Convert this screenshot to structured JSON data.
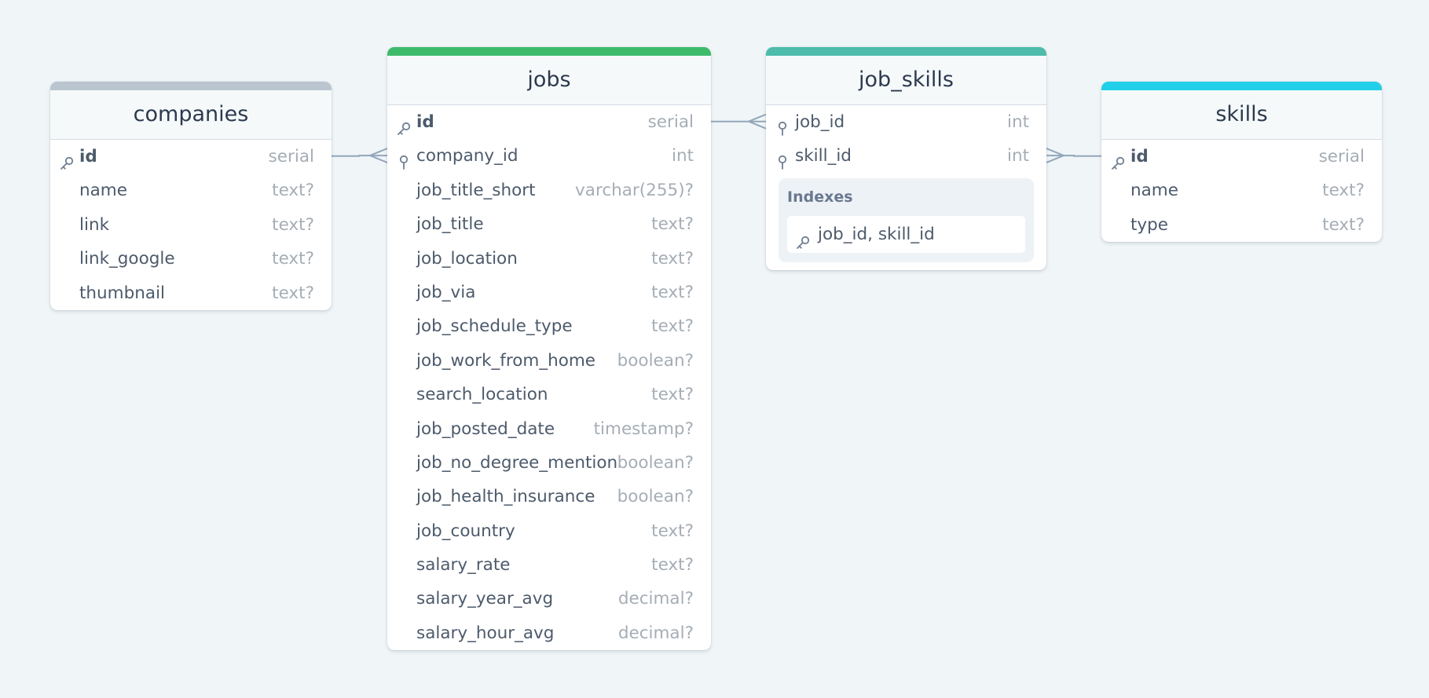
{
  "tables": [
    {
      "name": "companies",
      "accent_color": "#bac5d0",
      "columns": [
        {
          "name": "id",
          "type": "serial",
          "key": "pk"
        },
        {
          "name": "name",
          "type": "text?",
          "key": ""
        },
        {
          "name": "link",
          "type": "text?",
          "key": ""
        },
        {
          "name": "link_google",
          "type": "text?",
          "key": ""
        },
        {
          "name": "thumbnail",
          "type": "text?",
          "key": ""
        }
      ]
    },
    {
      "name": "jobs",
      "accent_color": "#3dbb6b",
      "columns": [
        {
          "name": "id",
          "type": "serial",
          "key": "pk"
        },
        {
          "name": "company_id",
          "type": "int",
          "key": "fk"
        },
        {
          "name": "job_title_short",
          "type": "varchar(255)?",
          "key": ""
        },
        {
          "name": "job_title",
          "type": "text?",
          "key": ""
        },
        {
          "name": "job_location",
          "type": "text?",
          "key": ""
        },
        {
          "name": "job_via",
          "type": "text?",
          "key": ""
        },
        {
          "name": "job_schedule_type",
          "type": "text?",
          "key": ""
        },
        {
          "name": "job_work_from_home",
          "type": "boolean?",
          "key": ""
        },
        {
          "name": "search_location",
          "type": "text?",
          "key": ""
        },
        {
          "name": "job_posted_date",
          "type": "timestamp?",
          "key": ""
        },
        {
          "name": "job_no_degree_mention",
          "type": "boolean?",
          "key": ""
        },
        {
          "name": "job_health_insurance",
          "type": "boolean?",
          "key": ""
        },
        {
          "name": "job_country",
          "type": "text?",
          "key": ""
        },
        {
          "name": "salary_rate",
          "type": "text?",
          "key": ""
        },
        {
          "name": "salary_year_avg",
          "type": "decimal?",
          "key": ""
        },
        {
          "name": "salary_hour_avg",
          "type": "decimal?",
          "key": ""
        }
      ]
    },
    {
      "name": "job_skills",
      "accent_color": "#4dbcaa",
      "columns": [
        {
          "name": "job_id",
          "type": "int",
          "key": "fk"
        },
        {
          "name": "skill_id",
          "type": "int",
          "key": "fk"
        }
      ],
      "indexes": {
        "title": "Indexes",
        "items": [
          {
            "columns": "job_id, skill_id",
            "key": "pk"
          }
        ]
      }
    },
    {
      "name": "skills",
      "accent_color": "#22cfe8",
      "columns": [
        {
          "name": "id",
          "type": "serial",
          "key": "pk"
        },
        {
          "name": "name",
          "type": "text?",
          "key": ""
        },
        {
          "name": "type",
          "type": "text?",
          "key": ""
        }
      ]
    }
  ],
  "relations": [
    {
      "from": "companies.id",
      "to": "jobs.company_id",
      "cardinality": "one-to-many"
    },
    {
      "from": "jobs.id",
      "to": "job_skills.job_id",
      "cardinality": "one-to-many"
    },
    {
      "from": "skills.id",
      "to": "job_skills.skill_id",
      "cardinality": "one-to-many"
    }
  ],
  "colors": {
    "background": "#f0f5f7",
    "edge": "#93a7bb",
    "icon": "#6f7f91"
  }
}
